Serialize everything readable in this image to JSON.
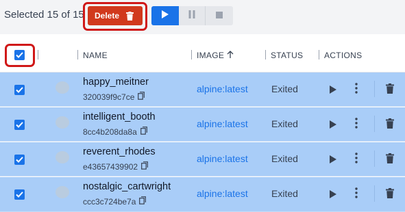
{
  "toolbar": {
    "selection_text": "Selected 15 of 15",
    "delete_label": "Delete",
    "accent_color": "#1a73e8",
    "danger_color": "#d1391d"
  },
  "table": {
    "headers": {
      "name": "NAME",
      "image": "IMAGE",
      "image_sort_icon": "arrow-up-icon",
      "status": "STATUS",
      "actions": "ACTIONS"
    },
    "select_all_checked": true,
    "rows": [
      {
        "name": "happy_meitner",
        "id": "320039f9c7ce",
        "image": "alpine:latest",
        "status": "Exited",
        "selected": true
      },
      {
        "name": "intelligent_booth",
        "id": "8cc4b208da8a",
        "image": "alpine:latest",
        "status": "Exited",
        "selected": true
      },
      {
        "name": "reverent_rhodes",
        "id": "e43657439902",
        "image": "alpine:latest",
        "status": "Exited",
        "selected": true
      },
      {
        "name": "nostalgic_cartwright",
        "id": "ccc3c724be7a",
        "image": "alpine:latest",
        "status": "Exited",
        "selected": true
      }
    ],
    "row_highlight_color": "#a9cdf8"
  }
}
